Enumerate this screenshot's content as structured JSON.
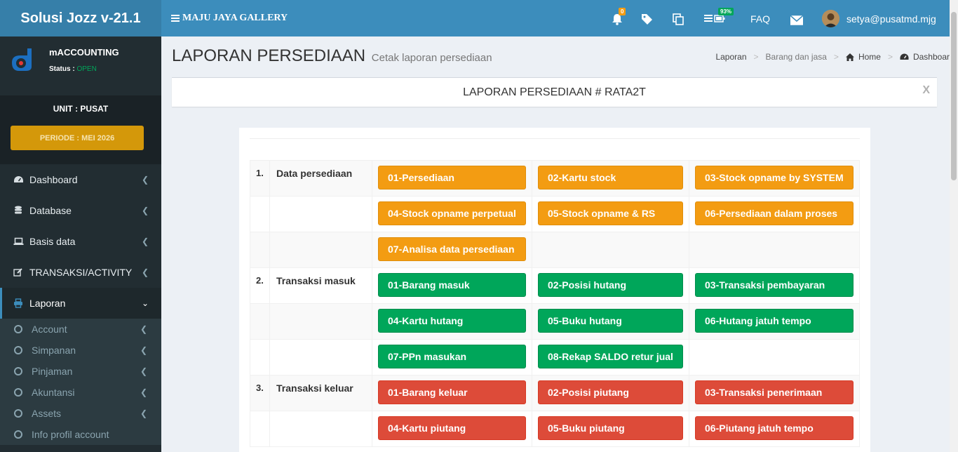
{
  "sidebar": {
    "app_title": "Solusi Jozz v-21.1",
    "user": {
      "name": "mACCOUNTING",
      "status_label": "Status :",
      "status_value": "OPEN"
    },
    "unit": "UNIT : PUSAT",
    "periode": "PERIODE : MEI 2026",
    "menu": [
      {
        "label": "Dashboard",
        "icon": "dashboard-icon"
      },
      {
        "label": "Database",
        "icon": "database-icon"
      },
      {
        "label": "Basis data",
        "icon": "laptop-icon"
      },
      {
        "label": "TRANSAKSI/ACTIVITY",
        "icon": "edit-icon"
      },
      {
        "label": "Laporan",
        "icon": "printer-icon",
        "active": true
      }
    ],
    "submenu": [
      {
        "label": "Account"
      },
      {
        "label": "Simpanan"
      },
      {
        "label": "Pinjaman"
      },
      {
        "label": "Akuntansi"
      },
      {
        "label": "Assets"
      },
      {
        "label": "Info profil account"
      }
    ]
  },
  "header": {
    "brand": "MAJU JAYA GALLERY",
    "notif_count": "0",
    "battery": "93%",
    "faq": "FAQ",
    "user_email": "setya@pusatmd.mjg"
  },
  "content": {
    "title": "LAPORAN PERSEDIAAN",
    "subtitle": "Cetak laporan persediaan",
    "breadcrumb": [
      "Laporan",
      "Barang dan jasa",
      "Home",
      "Dashboar"
    ],
    "banner": "LAPORAN PERSEDIAAN # RATA2T",
    "close": "X",
    "sections": [
      {
        "num": "1.",
        "label": "Data persediaan",
        "buttons": [
          "01-Persediaan",
          "02-Kartu stock",
          "03-Stock opname by SYSTEM",
          "04-Stock opname perpetual",
          "05-Stock opname & RS",
          "06-Persediaan dalam proses",
          "07-Analisa data persediaan"
        ]
      },
      {
        "num": "2.",
        "label": "Transaksi masuk",
        "buttons": [
          "01-Barang masuk",
          "02-Posisi hutang",
          "03-Transaksi pembayaran",
          "04-Kartu hutang",
          "05-Buku hutang",
          "06-Hutang jatuh tempo",
          "07-PPn masukan",
          "08-Rekap SALDO retur jual"
        ]
      },
      {
        "num": "3.",
        "label": "Transaksi keluar",
        "buttons": [
          "01-Barang keluar",
          "02-Posisi piutang",
          "03-Transaksi penerimaan",
          "04-Kartu piutang",
          "05-Buku piutang",
          "06-Piutang jatuh tempo"
        ]
      }
    ]
  },
  "colors": {
    "header": "#3c8dbc",
    "logo": "#367fa9",
    "sidebar": "#222d32",
    "orange": "#f39c12",
    "green": "#00a65a",
    "red": "#dd4b39",
    "periode": "#d4980a"
  }
}
